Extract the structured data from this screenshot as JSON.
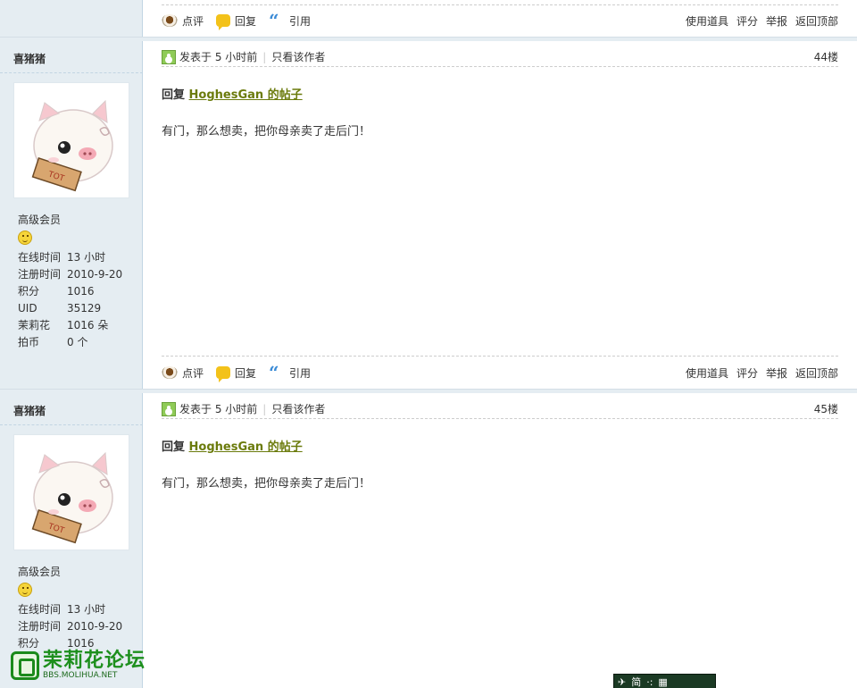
{
  "actions": {
    "comment": "点评",
    "reply": "回复",
    "quote": "引用",
    "use_tools": "使用道具",
    "rate": "评分",
    "report": "举报",
    "back_top": "返回顶部"
  },
  "posts": [
    {
      "author": "喜猪猪",
      "rank": "高级会员",
      "stats": [
        {
          "k": "在线时间",
          "v": "13 小时"
        },
        {
          "k": "注册时间",
          "v": "2010-9-20"
        },
        {
          "k": "积分",
          "v": "1016"
        },
        {
          "k": "UID",
          "v": "35129"
        },
        {
          "k": "茉莉花",
          "v": "1016 朵"
        },
        {
          "k": "拍币",
          "v": "0 个"
        }
      ],
      "posted": "发表于 5 小时前",
      "only_author": "只看该作者",
      "floor": "44楼",
      "reply_prefix": "回复",
      "reply_target": "HoghesGan 的帖子",
      "body": "有门，那么想卖，把你母亲卖了走后门！"
    },
    {
      "author": "喜猪猪",
      "rank": "高级会员",
      "stats": [
        {
          "k": "在线时间",
          "v": "13 小时"
        },
        {
          "k": "注册时间",
          "v": "2010-9-20"
        },
        {
          "k": "积分",
          "v": "1016"
        }
      ],
      "posted": "发表于 5 小时前",
      "only_author": "只看该作者",
      "floor": "45楼",
      "reply_prefix": "回复",
      "reply_target": "HoghesGan 的帖子",
      "body": "有门，那么想卖，把你母亲卖了走后门！"
    }
  ],
  "logo": {
    "cn": "茉莉花论坛",
    "en": "BBS.MOLIHUA.NET"
  },
  "ime": {
    "label": "简"
  }
}
